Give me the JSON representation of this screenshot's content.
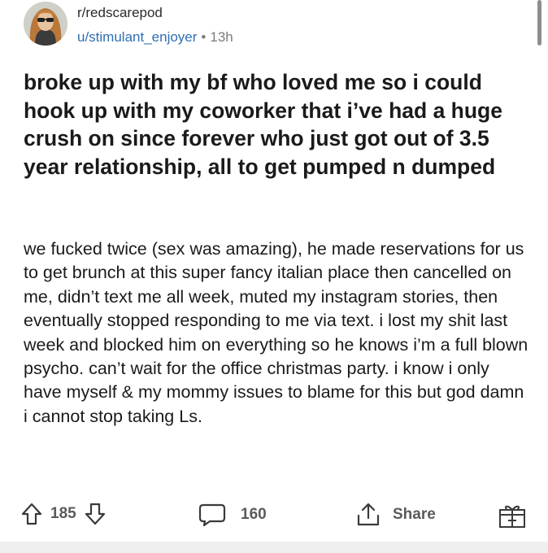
{
  "post": {
    "subreddit": "r/redscarepod",
    "username": "u/stimulant_enjoyer",
    "separator": "•",
    "time_ago": "13h",
    "title": "broke up with my bf who loved me so i could hook up with my coworker that i’ve had a huge crush on since forever who just got out of 3.5 year relationship, all to get pumped n dumped",
    "body": "we fucked twice (sex was amazing), he made reservations for us to get brunch at this super fancy italian place then cancelled on me, didn’t text me all week, muted my instagram stories, then eventually stopped responding to me via text. i lost my shit last week and blocked him on everything so he knows i’m a full blown psycho. can’t wait for the office christmas party. i know i only have myself & my mommy issues to blame for this but god damn i cannot stop taking Ls."
  },
  "actions": {
    "upvote_count": "185",
    "comment_count": "160",
    "share_label": "Share"
  },
  "icons": {
    "upvote": "arrow-up-icon",
    "downvote": "arrow-down-icon",
    "comment": "speech-bubble-icon",
    "share": "share-icon",
    "award": "gift-icon"
  },
  "colors": {
    "username": "#2f6fb3",
    "meta_gray": "#7c7c7c",
    "text": "#1a1a1b"
  }
}
